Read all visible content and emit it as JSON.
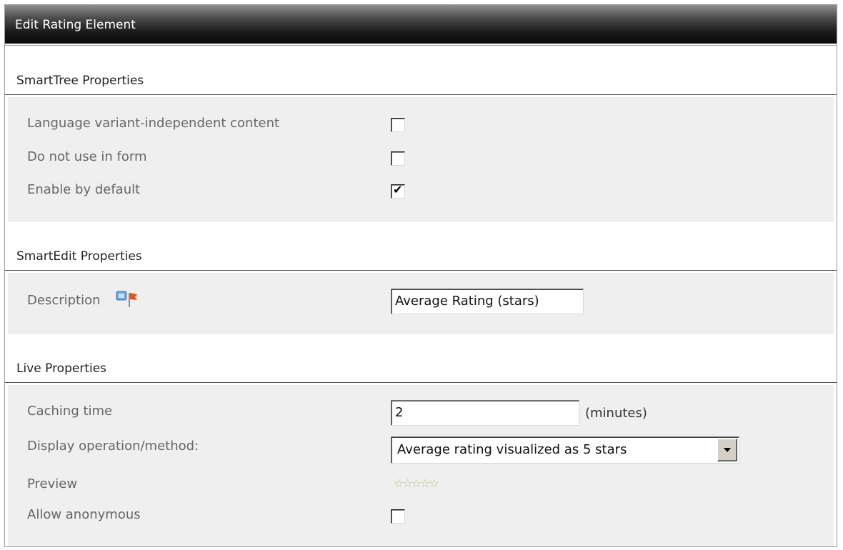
{
  "dialog": {
    "title": "Edit Rating Element"
  },
  "smarttree": {
    "heading": "SmartTree Properties",
    "rows": [
      {
        "label": "Language variant-independent content",
        "checked": false
      },
      {
        "label": "Do not use in form",
        "checked": false
      },
      {
        "label": "Enable by default",
        "checked": true
      }
    ]
  },
  "smartedit": {
    "heading": "SmartEdit Properties",
    "description": {
      "label": "Description",
      "value": "Average Rating (stars)",
      "icon": "flag-info-icon"
    }
  },
  "live": {
    "heading": "Live Properties",
    "caching": {
      "label": "Caching time",
      "value": "2",
      "unit": "(minutes)"
    },
    "display": {
      "label": "Display operation/method:",
      "selected": "Average rating visualized as 5 stars"
    },
    "preview": {
      "label": "Preview",
      "stars": "☆☆☆☆☆",
      "rating": 0,
      "max": 5
    },
    "anonymous": {
      "label": "Allow anonymous",
      "checked": false
    }
  },
  "colors": {
    "titlebar": "#1a1a1a",
    "panel": "#efefef",
    "star": "#b8bf8e"
  }
}
